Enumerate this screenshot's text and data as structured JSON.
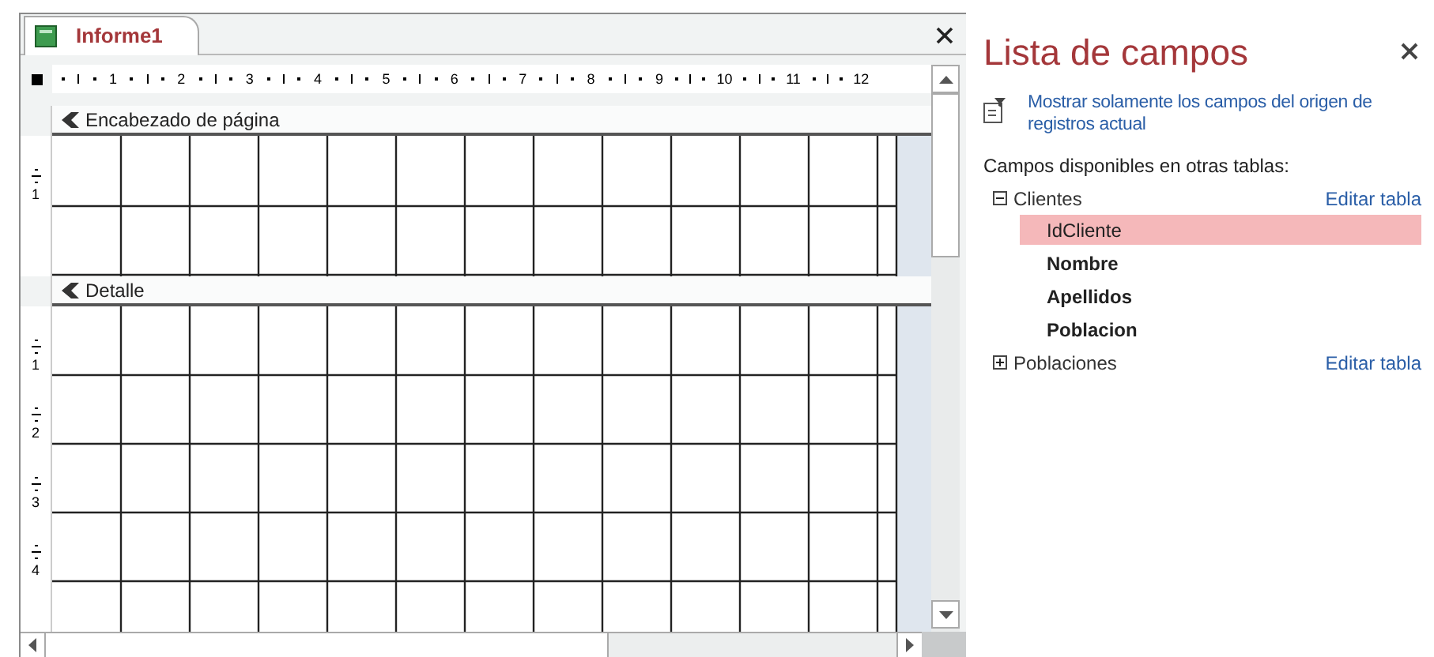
{
  "document_tab": {
    "title": "Informe1",
    "selected": true
  },
  "ruler": {
    "numbers": [
      "1",
      "2",
      "3",
      "4",
      "5",
      "6",
      "7",
      "8",
      "9",
      "10",
      "11",
      "12"
    ]
  },
  "sections": [
    {
      "title": "Encabezado de página",
      "ruler_numbers": [
        "1"
      ]
    },
    {
      "title": "Detalle",
      "ruler_numbers": [
        "1",
        "2",
        "3",
        "4"
      ]
    }
  ],
  "field_list": {
    "title": "Lista de campos",
    "show_only_link": "Mostrar solamente los campos del origen de registros actual",
    "available_label": "Campos disponibles en otras tablas:",
    "tables": [
      {
        "name": "Clientes",
        "expanded": true,
        "edit_link": "Editar tabla",
        "fields": [
          {
            "name": "IdCliente",
            "selected": true
          },
          {
            "name": "Nombre",
            "selected": false
          },
          {
            "name": "Apellidos",
            "selected": false
          },
          {
            "name": "Poblacion",
            "selected": false
          }
        ]
      },
      {
        "name": "Poblaciones",
        "expanded": false,
        "edit_link": "Editar tabla"
      }
    ]
  }
}
